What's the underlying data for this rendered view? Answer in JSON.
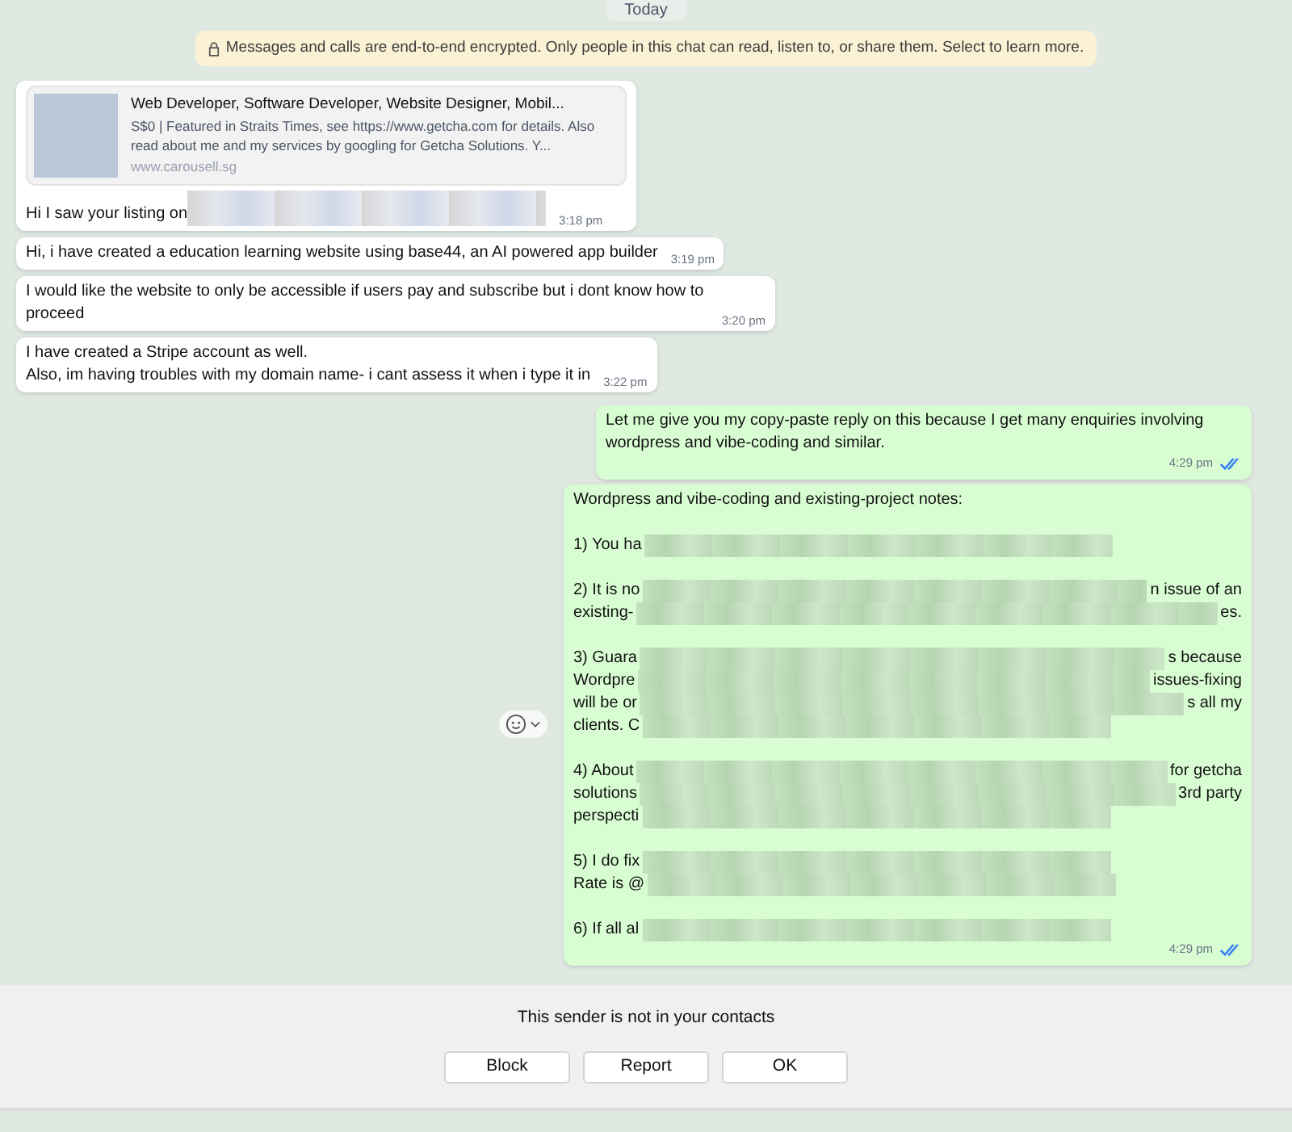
{
  "date_chip": "Today",
  "encryption_notice": "Messages and calls are end-to-end encrypted. Only people in this chat can read, listen to, or share them. Select to learn more.",
  "incoming": [
    {
      "kind": "preview",
      "link_preview": {
        "title": "Web Developer, Software Developer, Website Designer, Mobil...",
        "description": "S$0 | Featured in Straits Times, see https://www.getcha.com for details. Also read about me and my services by googling for Getcha Solutions. Y...",
        "domain": "www.carousell.sg"
      },
      "text": "Hi I saw your listing on",
      "redacted": true,
      "time": "3:18 pm"
    },
    {
      "kind": "text",
      "text": "Hi, i have created a education learning website using base44, an AI powered app builder",
      "redacted": false,
      "time": "3:19 pm"
    },
    {
      "kind": "text",
      "text": "I would like the website to only be accessible if users pay and subscribe but i dont know how to proceed",
      "redacted": false,
      "time": "3:20 pm"
    },
    {
      "kind": "text",
      "text": "I have created a Stripe account as well.\nAlso, im having troubles with my domain name- i cant assess it when i type it in",
      "redacted": false,
      "time": "3:22 pm"
    }
  ],
  "outgoing": [
    {
      "text": "Let me give you my copy-paste reply on this because I get many enquiries involving wordpress and vibe-coding and similar.",
      "time": "4:29 pm",
      "read": true
    },
    {
      "heading": "Wordpress and vibe-coding and existing-project notes:",
      "paragraphs": [
        [
          {
            "start": "1) You ha"
          }
        ],
        [
          {
            "start": "2) It is no",
            "end": "n issue of an"
          },
          {
            "start": "existing-",
            "end": "es."
          }
        ],
        [
          {
            "start": "3) Guara",
            "end": "s because"
          },
          {
            "start": "Wordpre",
            "end": "issues-fixing"
          },
          {
            "start": "will be or",
            "end": "s all my"
          },
          {
            "start": "clients. C"
          }
        ],
        [
          {
            "start": "4) About",
            "end": "for getcha"
          },
          {
            "start": "solutions",
            "end": "3rd party"
          },
          {
            "start": "perspecti"
          }
        ],
        [
          {
            "start": "5) I do fix"
          },
          {
            "start": "Rate is @"
          }
        ],
        [
          {
            "start": "6) If all al"
          }
        ]
      ],
      "time": "4:29 pm",
      "read": true
    }
  ],
  "footer": {
    "notice": "This sender is not in your contacts",
    "buttons": [
      "Block",
      "Report",
      "OK"
    ]
  }
}
